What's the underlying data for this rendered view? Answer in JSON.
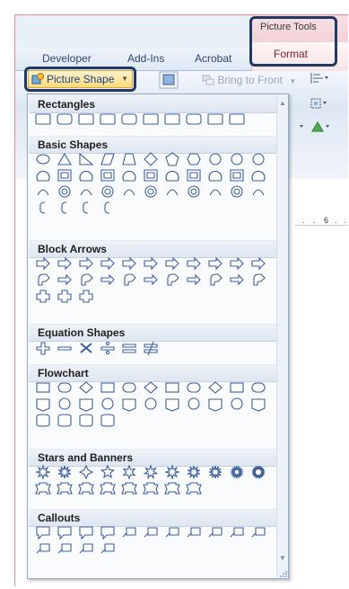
{
  "contextual_group": {
    "title": "Picture Tools"
  },
  "tabs": [
    {
      "label": "Developer"
    },
    {
      "label": "Add-Ins"
    },
    {
      "label": "Acrobat"
    },
    {
      "label": "Format"
    }
  ],
  "ribbon": {
    "picture_shape_label": "Picture Shape",
    "bring_to_front_label": "Bring to Front"
  },
  "ruler": {
    "marks": [
      ".",
      ".",
      "6",
      ".",
      "."
    ]
  },
  "gallery": {
    "sections": [
      {
        "title": "Rectangles"
      },
      {
        "title": "Basic Shapes"
      },
      {
        "title": "Block Arrows"
      },
      {
        "title": "Equation Shapes"
      },
      {
        "title": "Flowchart"
      },
      {
        "title": "Stars and Banners"
      },
      {
        "title": "Callouts"
      }
    ]
  },
  "colors": {
    "contextual_accent": "#f2cfd4",
    "highlight_border": "#1f3864",
    "shape_outline": "#3b5f9a"
  },
  "icons": [
    "picture-shape-icon",
    "dropdown-arrow-icon",
    "bring-to-front-icon",
    "scroll-up-icon",
    "scroll-down-icon",
    "resize-grip-icon"
  ]
}
